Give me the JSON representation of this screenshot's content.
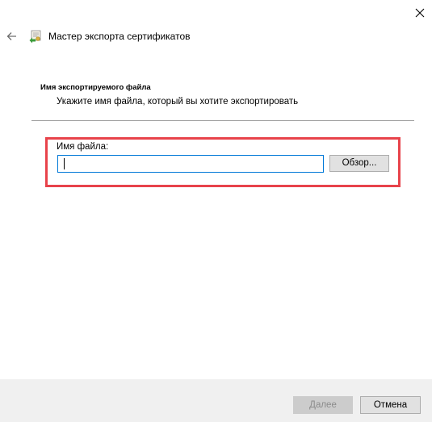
{
  "window": {
    "title": "Мастер экспорта сертификатов"
  },
  "page": {
    "heading": "Имя экспортируемого файла",
    "description": "Укажите имя файла, который вы хотите экспортировать"
  },
  "file_field": {
    "label": "Имя файла:",
    "value": "",
    "browse_label": "Обзор..."
  },
  "footer": {
    "next_label": "Далее",
    "next_enabled": false,
    "cancel_label": "Отмена"
  },
  "colors": {
    "highlight_border": "#e8434b",
    "input_focus_border": "#0078d7",
    "footer_background": "#f0f0f0"
  },
  "icons": {
    "back": "back-arrow-icon",
    "wizard": "certificate-wizard-icon",
    "close": "close-icon"
  }
}
